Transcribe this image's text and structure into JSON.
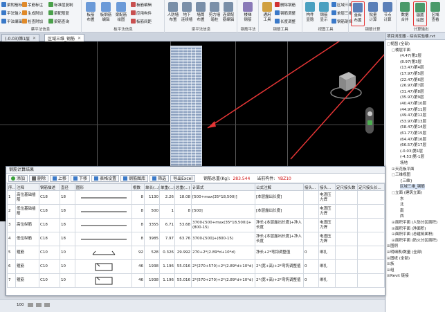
{
  "ribbon": {
    "groups": [
      {
        "label": "蔡平法信息",
        "small": [
          "梁附筋标",
          "平法编辑",
          "平法输入",
          "吊筋标注",
          "生成附加",
          "检查附加",
          "标准层复制",
          "梁配筋复",
          "平法选择",
          "梁筋编辑",
          "梁筋查询",
          "梁配筋"
        ]
      },
      {
        "label": "板平法信息",
        "large": [
          "板筋\n布置",
          "板钢筋\n编辑",
          "梁配筋\n绘图"
        ],
        "small": [
          "板筋编辑",
          "应用构件",
          "板筋间距"
        ]
      },
      {
        "label": "梁平法信息",
        "large": [
          "人防墙\n布置",
          "地下\n连续墙",
          "墙筒\n布置",
          "剪力墙\n暗柱",
          "连梁配\n筋编辑"
        ]
      },
      {
        "label": "钢筋平法",
        "large": [
          "楼梯\n钢筋",
          "钢筋\n平法"
        ]
      },
      {
        "label": "钢筋工具",
        "large": [
          "通用\n工具",
          "构件\n钢筋"
        ],
        "small": [
          "删除钢筋",
          "钢筋调整",
          "长度调整"
        ]
      },
      {
        "label": "视图工具",
        "large": [
          "构件\n显隐",
          "钢筋\n显示"
        ],
        "small": [
          "区域三维",
          "单层三维",
          "钢筋剖切"
        ]
      },
      {
        "label": "钢筋计算",
        "large": [
          "单构\n布置",
          "批量\n计算",
          "节点\n计算"
        ]
      },
      {
        "label": "计算输出",
        "large": [
          "数据\n合并",
          "钢筋\n绘图",
          "区域\n查看"
        ]
      }
    ]
  },
  "tabs": [
    {
      "label": "(-0.03)第1层",
      "active": false
    },
    {
      "label": "区域三维_钢筋",
      "active": true
    }
  ],
  "browser": {
    "title": "项目浏览器 - 综合实验楼.rvt",
    "items": [
      {
        "label": "视图 (全部)",
        "level": 0,
        "tw": "□"
      },
      {
        "label": "楼层平面",
        "level": 1,
        "tw": "□"
      },
      {
        "label": "(4.47)第2层",
        "level": 2
      },
      {
        "label": "(8.97)第3层",
        "level": 2
      },
      {
        "label": "(13.47)第4层",
        "level": 2
      },
      {
        "label": "(17.97)第5层",
        "level": 2
      },
      {
        "label": "(22.47)第6层",
        "level": 2
      },
      {
        "label": "(26.97)第7层",
        "level": 2
      },
      {
        "label": "(31.47)第8层",
        "level": 2
      },
      {
        "label": "(35.97)第9层",
        "level": 2
      },
      {
        "label": "(40.47)第10层",
        "level": 2
      },
      {
        "label": "(44.97)第11层",
        "level": 2
      },
      {
        "label": "(49.47)第12层",
        "level": 2
      },
      {
        "label": "(53.97)第13层",
        "level": 2
      },
      {
        "label": "(58.47)第14层",
        "level": 2
      },
      {
        "label": "(61.77)第15层",
        "level": 2
      },
      {
        "label": "(64.47)第16层",
        "level": 2
      },
      {
        "label": "(66.57)第17层",
        "level": 2
      },
      {
        "label": "(-0.03)第1层",
        "level": 2
      },
      {
        "label": "(-4.53)第-1层",
        "level": 2
      },
      {
        "label": "场地",
        "level": 2
      },
      {
        "label": "天花板平面",
        "level": 1,
        "tw": "⊞"
      },
      {
        "label": "三维视图",
        "level": 1,
        "tw": "□"
      },
      {
        "label": "{三维}",
        "level": 2
      },
      {
        "label": "区域三维_钢筋",
        "level": 2,
        "sel": true
      },
      {
        "label": "立面 (建筑立面)",
        "level": 1,
        "tw": "□"
      },
      {
        "label": "东",
        "level": 2
      },
      {
        "label": "北",
        "level": 2
      },
      {
        "label": "南",
        "level": 2
      },
      {
        "label": "西",
        "level": 2
      },
      {
        "label": "面积平面 (人防分区面积)",
        "level": 1,
        "tw": "⊞"
      },
      {
        "label": "面积平面 (净面积)",
        "level": 1,
        "tw": "⊞"
      },
      {
        "label": "面积平面 (总建筑面积)",
        "level": 1,
        "tw": "⊞"
      },
      {
        "label": "面积平面 (防火分区面积)",
        "level": 1,
        "tw": "⊞"
      },
      {
        "label": "图例",
        "level": 0,
        "tw": "⊞"
      },
      {
        "label": "明细表/数量 (全部)",
        "level": 0,
        "tw": "⊞"
      },
      {
        "label": "图纸 (全部)",
        "level": 0,
        "tw": "⊞"
      },
      {
        "label": "族",
        "level": 0,
        "tw": "⊞"
      },
      {
        "label": "组",
        "level": 0,
        "tw": "⊞"
      },
      {
        "label": "Revit 链接",
        "level": 0,
        "tw": "⊞"
      }
    ]
  },
  "dialog": {
    "title": "钢筋计算结果",
    "toolbar": [
      "添加",
      "删除",
      "上移",
      "下移",
      "表格设置",
      "钢筋图库",
      "筛选",
      "导出Excel"
    ],
    "total_label": "钢筋总重(Kg):",
    "total_value": "283.544",
    "member_label": "当前构件:",
    "member_value": "YBZ10",
    "headers": [
      "序..",
      "注释",
      "钢筋描述",
      "直径",
      "图形",
      "根数",
      "单长(...)",
      "单重(...)",
      "总重(...)",
      "计算式",
      "公式注解",
      "接头...",
      "接头...",
      "定尺接头数",
      "定尺接头长..."
    ],
    "rows": [
      {
        "no": "1",
        "note": "高位基础插筋",
        "desc": "C18",
        "dia": "18",
        "shape": "line",
        "count": "8",
        "len": "1130",
        "unit": "2.26",
        "total": "18.08",
        "formula": "[500+max(35*18,500)]",
        "remark": "[本层露出长度]",
        "j1": "",
        "j2": "电渣压力焊"
      },
      {
        "no": "2",
        "note": "低位基础插筋",
        "desc": "C18",
        "dia": "18",
        "shape": "line",
        "count": "8",
        "len": "500",
        "unit": "1",
        "total": "8",
        "formula": "[500]",
        "remark": "[本层露出长度]",
        "j1": "",
        "j2": "电渣压力焊"
      },
      {
        "no": "3",
        "note": "高位纵筋",
        "desc": "C18",
        "dia": "18",
        "shape": "line",
        "count": "8",
        "len": "3355",
        "unit": "6.71",
        "total": "53.68",
        "formula": "3700-[500+max(35*18,500)]+(800-15)",
        "remark": "净长-[本层露出长度]+净入长度",
        "j1": "",
        "j2": "电渣压力焊"
      },
      {
        "no": "4",
        "note": "低位纵筋",
        "desc": "C18",
        "dia": "18",
        "shape": "line",
        "count": "8",
        "len": "3985",
        "unit": "7.97",
        "total": "63.76",
        "formula": "3700-[500]+(800-15)",
        "remark": "净长-[本层露出长度]+净入长度",
        "j1": "",
        "j2": "电渣压力焊"
      },
      {
        "no": "5",
        "note": "箍筋",
        "desc": "C10",
        "dia": "10",
        "shape": "hook",
        "count": "92",
        "len": "528",
        "unit": "0.326",
        "total": "29.992",
        "formula": "270+2*(2.89*d+10*d)",
        "remark": "净长+2*弯钩调整值",
        "j1": "0",
        "j2": "绑扎"
      },
      {
        "no": "6",
        "note": "箍筋",
        "desc": "C10",
        "dia": "10",
        "shape": "rect",
        "count": "46",
        "len": "1938",
        "unit": "1.196",
        "total": "55.016",
        "formula": "2*(270+570)+2*(2.89*d+10*d)",
        "remark": "2*(宽+高)+2*弯钩调整值",
        "j1": "0",
        "j2": "绑扎"
      },
      {
        "no": "7",
        "note": "箍筋",
        "desc": "C10",
        "dia": "10",
        "shape": "rect",
        "count": "46",
        "len": "1938",
        "unit": "1.196",
        "total": "55.016",
        "formula": "2*(570+270)+2*(2.89*d+10*d)",
        "remark": "2*(宽+高)+2*弯钩调整值",
        "j1": "0",
        "j2": "绑扎"
      }
    ]
  },
  "status": {
    "zoom": "100"
  },
  "colors": {
    "accent_red": "#e53535",
    "viewport_bg": "#000000"
  }
}
